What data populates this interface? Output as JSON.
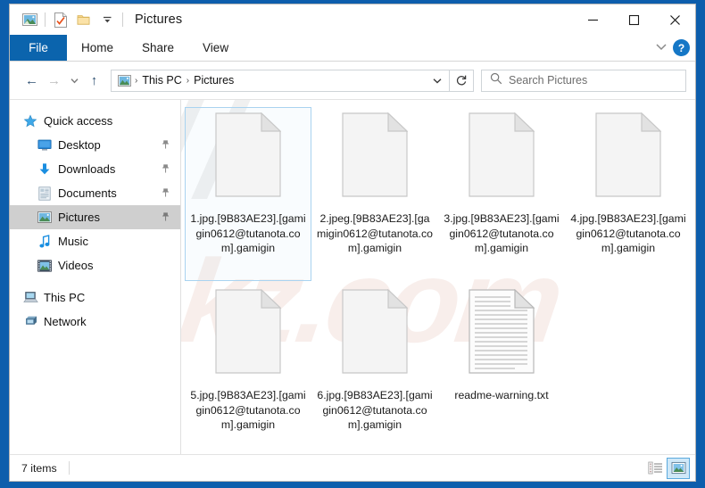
{
  "window": {
    "title": "Pictures",
    "quick_access_icons": [
      "pictures-folder-icon",
      "properties-icon",
      "new-folder-icon",
      "customize-chevron-icon"
    ],
    "controls": {
      "minimize": "─",
      "maximize": "☐",
      "close": "✕"
    }
  },
  "ribbon": {
    "tabs": [
      {
        "label": "File",
        "active": true
      },
      {
        "label": "Home",
        "active": false
      },
      {
        "label": "Share",
        "active": false
      },
      {
        "label": "View",
        "active": false
      }
    ],
    "expand_chevron": "⌄",
    "help_label": "?"
  },
  "address": {
    "back": "←",
    "forward": "→",
    "recent": "⌄",
    "up": "↑",
    "breadcrumb": [
      "This PC",
      "Pictures"
    ],
    "separator": "›",
    "dropdown": "⌄",
    "refresh": "↻"
  },
  "search": {
    "placeholder": "Search Pictures",
    "icon": "search-icon"
  },
  "sidebar": {
    "items": [
      {
        "label": "Quick access",
        "icon": "star-icon",
        "level": 0,
        "pinned": false,
        "selected": false
      },
      {
        "label": "Desktop",
        "icon": "desktop-icon",
        "level": 1,
        "pinned": true,
        "selected": false
      },
      {
        "label": "Downloads",
        "icon": "downloads-icon",
        "level": 1,
        "pinned": true,
        "selected": false
      },
      {
        "label": "Documents",
        "icon": "documents-icon",
        "level": 1,
        "pinned": true,
        "selected": false
      },
      {
        "label": "Pictures",
        "icon": "pictures-icon",
        "level": 1,
        "pinned": true,
        "selected": true
      },
      {
        "label": "Music",
        "icon": "music-icon",
        "level": 1,
        "pinned": false,
        "selected": false
      },
      {
        "label": "Videos",
        "icon": "videos-icon",
        "level": 1,
        "pinned": false,
        "selected": false
      },
      {
        "label": "This PC",
        "icon": "this-pc-icon",
        "level": 0,
        "pinned": false,
        "selected": false
      },
      {
        "label": "Network",
        "icon": "network-icon",
        "level": 0,
        "pinned": false,
        "selected": false
      }
    ],
    "pin_glyph": "📌"
  },
  "files": [
    {
      "name": "1.jpg.[9B83AE23].[gamigin0612@tutanota.com].gamigin",
      "icon": "blank-file-icon",
      "selected": true
    },
    {
      "name": "2.jpeg.[9B83AE23].[gamigin0612@tutanota.com].gamigin",
      "icon": "blank-file-icon",
      "selected": false
    },
    {
      "name": "3.jpg.[9B83AE23].[gamigin0612@tutanota.com].gamigin",
      "icon": "blank-file-icon",
      "selected": false
    },
    {
      "name": "4.jpg.[9B83AE23].[gamigin0612@tutanota.com].gamigin",
      "icon": "blank-file-icon",
      "selected": false
    },
    {
      "name": "5.jpg.[9B83AE23].[gamigin0612@tutanota.com].gamigin",
      "icon": "blank-file-icon",
      "selected": false
    },
    {
      "name": "6.jpg.[9B83AE23].[gamigin0612@tutanota.com].gamigin",
      "icon": "blank-file-icon",
      "selected": false
    },
    {
      "name": "readme-warning.txt",
      "icon": "text-file-icon",
      "selected": false
    }
  ],
  "status": {
    "item_count": "7 items",
    "views": [
      {
        "name": "details-view",
        "active": false
      },
      {
        "name": "large-icons-view",
        "active": true
      }
    ]
  },
  "watermark": {
    "text": "riskz.com"
  },
  "colors": {
    "accent": "#0b64ad",
    "desktop": "#0d5eac",
    "selection_border": "#a9d3f0",
    "sidebar_selected": "#cfcfcf",
    "help_blue": "#1577c6",
    "view_active_bg": "#cfe8f8"
  }
}
